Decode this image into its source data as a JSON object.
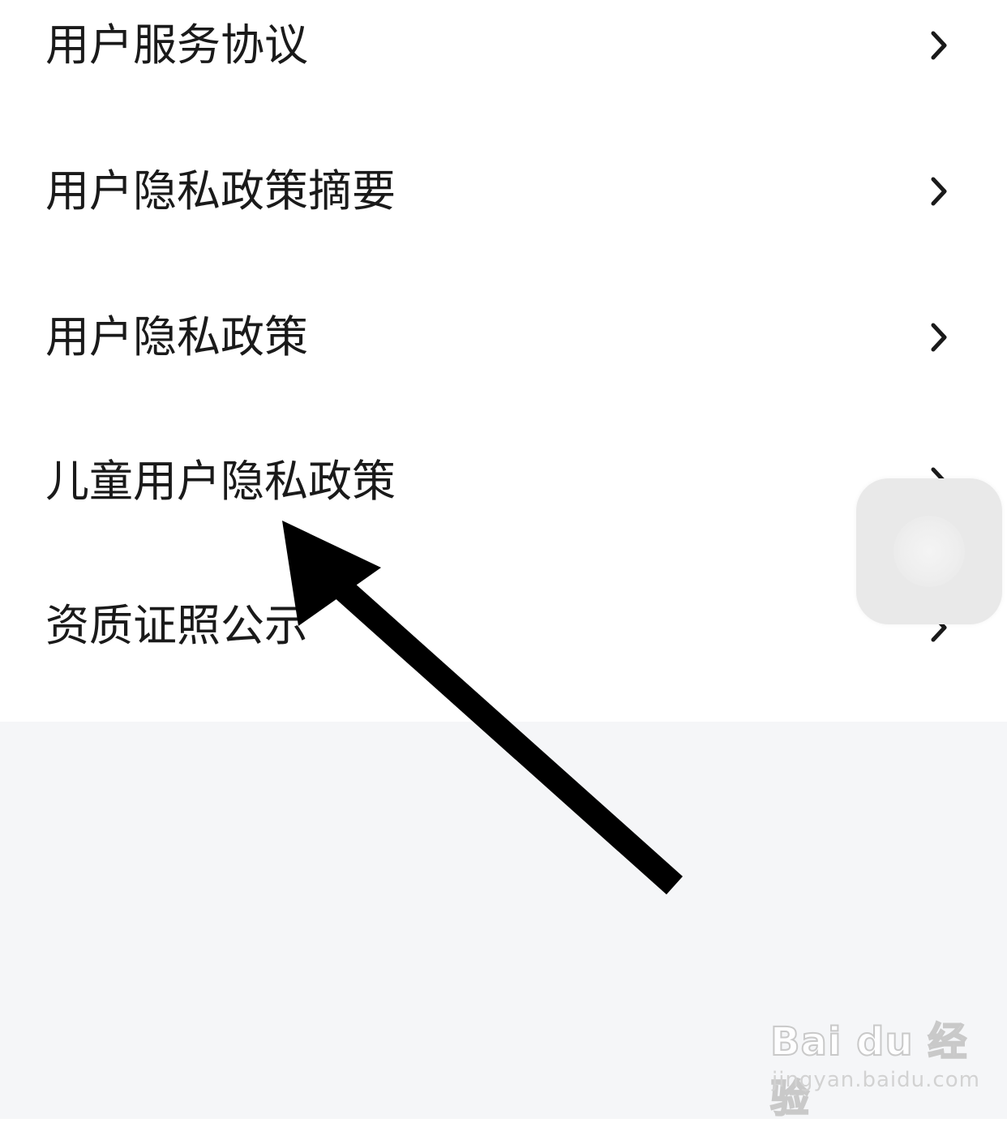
{
  "menu": {
    "items": [
      {
        "label": "用户服务协议"
      },
      {
        "label": "用户隐私政策摘要"
      },
      {
        "label": "用户隐私政策"
      },
      {
        "label": "儿童用户隐私政策"
      },
      {
        "label": "资质证照公示"
      }
    ]
  },
  "icons": {
    "chevron": "chevron-right-icon",
    "floating": "assistive-touch-icon",
    "annotation": "pointer-arrow"
  },
  "watermark": {
    "brand": "Bai du 经验",
    "url": "jingyan.baidu.com"
  },
  "colors": {
    "text": "#1a1a1a",
    "background": "#ffffff",
    "footer_background": "#f5f6f8",
    "arrow": "#000000"
  }
}
